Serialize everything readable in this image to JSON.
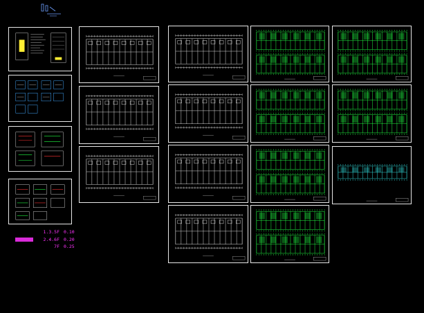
{
  "window": {
    "title": ""
  },
  "colors": {
    "background": "#000000",
    "sheet_border": "#e8e8e8",
    "plan_green": "#22ff44",
    "plan_cyan": "#33dddd",
    "legend_magenta": "#ff33ff",
    "highlight_yellow": "#ffee33"
  },
  "legend": {
    "rows": [
      {
        "key": "1.3.5F",
        "value": "0.10"
      },
      {
        "key": "2.4.6F",
        "value": "0.20"
      },
      {
        "key": "7F",
        "value": "0.25"
      }
    ]
  },
  "sheets": [
    {
      "id": "cover-1",
      "type": "index"
    },
    {
      "id": "cover-2",
      "type": "schedule"
    },
    {
      "id": "cover-3",
      "type": "details"
    },
    {
      "id": "cover-4",
      "type": "details"
    },
    {
      "id": "plan-a1",
      "type": "plan-white"
    },
    {
      "id": "plan-a2",
      "type": "plan-white"
    },
    {
      "id": "plan-a3",
      "type": "plan-white"
    },
    {
      "id": "plan-b1",
      "type": "plan-white"
    },
    {
      "id": "plan-b2",
      "type": "plan-white"
    },
    {
      "id": "plan-b3",
      "type": "plan-white"
    },
    {
      "id": "plan-b4",
      "type": "plan-white"
    },
    {
      "id": "plan-c1",
      "type": "plan-green"
    },
    {
      "id": "plan-c2",
      "type": "plan-green"
    },
    {
      "id": "plan-c3",
      "type": "plan-green"
    },
    {
      "id": "plan-c4",
      "type": "plan-green"
    },
    {
      "id": "plan-d1",
      "type": "plan-green"
    },
    {
      "id": "plan-d2",
      "type": "plan-green"
    },
    {
      "id": "plan-d3",
      "type": "plan-cyan"
    }
  ]
}
